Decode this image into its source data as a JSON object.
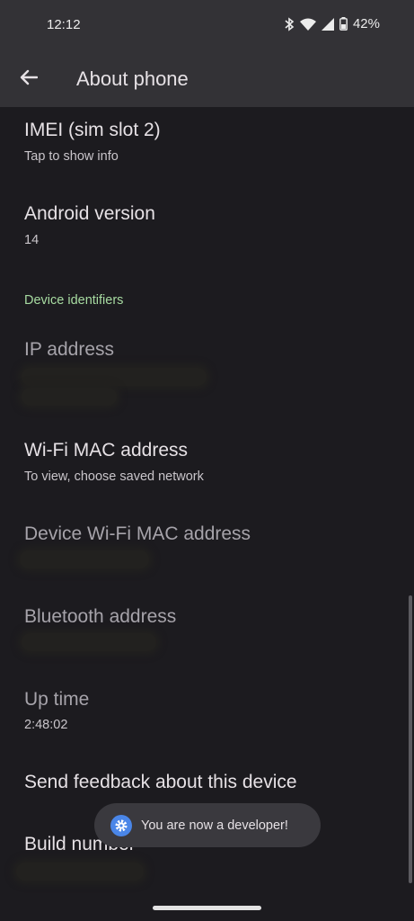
{
  "status_bar": {
    "time": "12:12",
    "battery": "42%",
    "icons": [
      "bluetooth-icon",
      "wifi-icon",
      "signal-icon",
      "battery-icon"
    ]
  },
  "app_bar": {
    "title": "About phone",
    "back_icon": "arrow-back-icon"
  },
  "items": {
    "imei2": {
      "title": "IMEI (sim slot 2)",
      "summary": "Tap to show info"
    },
    "android_version": {
      "title": "Android version",
      "summary": "14"
    },
    "section_device_identifiers": "Device identifiers",
    "ip_address": {
      "title": "IP address"
    },
    "wifi_mac": {
      "title": "Wi-Fi MAC address",
      "summary": "To view, choose saved network"
    },
    "device_wifi_mac": {
      "title": "Device Wi-Fi MAC address"
    },
    "bluetooth_address": {
      "title": "Bluetooth address"
    },
    "up_time": {
      "title": "Up time",
      "summary": "2:48:02"
    },
    "send_feedback": {
      "title": "Send feedback about this device"
    },
    "build_number": {
      "title": "Build number"
    }
  },
  "toast": {
    "text": "You are now a developer!",
    "icon": "settings-gear-icon"
  },
  "colors": {
    "background": "#1c1b1f",
    "app_bar": "#333236",
    "accent_section": "#a7dba1",
    "toast_icon": "#4a86e8"
  }
}
